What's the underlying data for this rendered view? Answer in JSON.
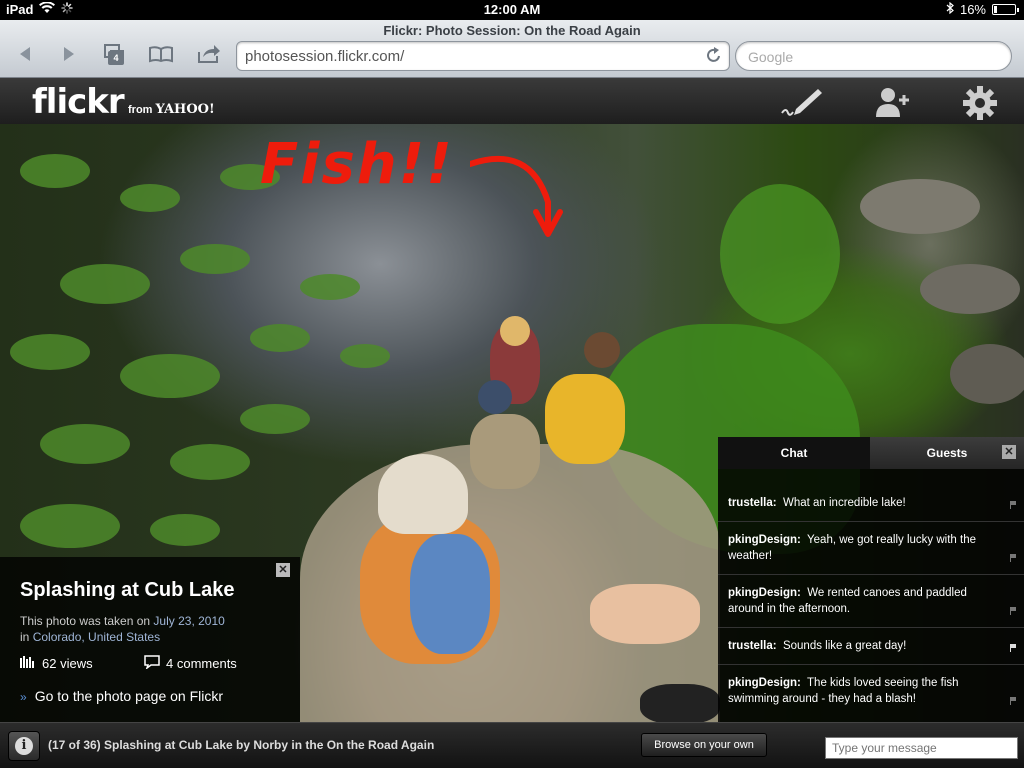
{
  "status_bar": {
    "device": "iPad",
    "time": "12:00 AM",
    "battery": "16%"
  },
  "browser": {
    "title": "Flickr: Photo Session: On the Road Again",
    "tab_count": "4",
    "url": "photosession.flickr.com/",
    "search_placeholder": "Google"
  },
  "flickr_header": {
    "logo": "flickr",
    "from": "from",
    "yahoo": "YAHOO!"
  },
  "photo": {
    "annotation": "Fish!!"
  },
  "info_panel": {
    "title": "Splashing at Cub Lake",
    "taken_prefix": "This photo was taken on ",
    "taken_date": "July 23, 2010",
    "location_prefix": "in ",
    "location_city": "Colorado",
    "location_country": ", United States",
    "views": "62 views",
    "comments": "4 comments",
    "go_link": "Go to the photo page on Flickr"
  },
  "chat_panel": {
    "tabs": [
      "Chat",
      "Guests"
    ],
    "messages": [
      {
        "user": "trustella:",
        "text": "What an incredible lake!",
        "flag_active": false
      },
      {
        "user": "pkingDesign:",
        "text": "Yeah, we got really lucky with the weather!",
        "flag_active": false
      },
      {
        "user": "pkingDesign:",
        "text": "We rented canoes and paddled around in the afternoon.",
        "flag_active": false
      },
      {
        "user": "trustella:",
        "text": "Sounds like a great day!",
        "flag_active": true
      },
      {
        "user": "pkingDesign:",
        "text": "The kids loved seeing the fish swimming around - they had a blash!",
        "flag_active": false
      }
    ]
  },
  "bottom_bar": {
    "caption": "(17 of 36) Splashing at Cub Lake by Norby in the On the Road Again",
    "browse_button": "Browse on your own",
    "message_placeholder": "Type your message"
  }
}
